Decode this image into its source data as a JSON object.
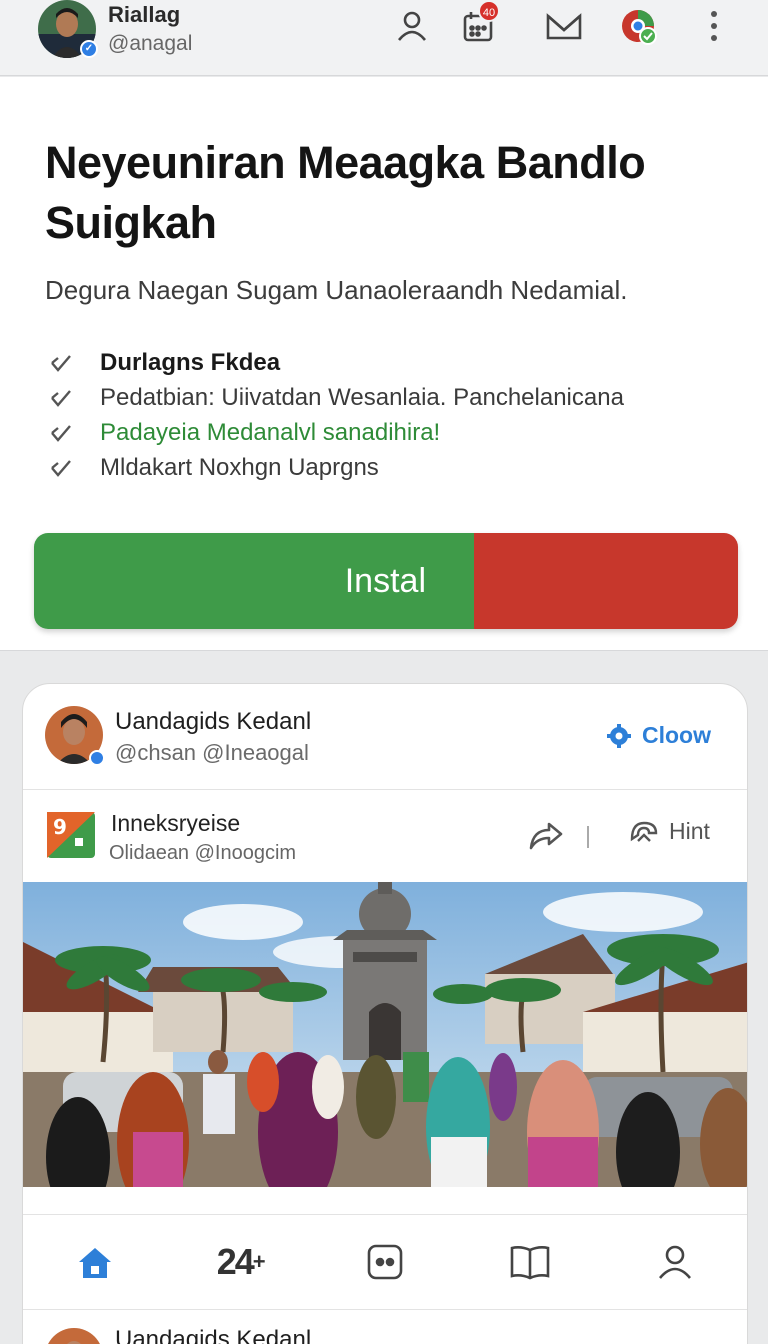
{
  "profile": {
    "name": "Riallag",
    "handle": "@anagal"
  },
  "topbar": {
    "calendar_badge": "40"
  },
  "promo": {
    "title": "Neyeuniran Meaagka Bandlo Suigkah",
    "subtitle": "Degura Naegan Sugam Uanaoleraandh Nedamial.",
    "features": [
      {
        "label": "Durlagns Fkdea"
      },
      {
        "label": "Pedatbian: Uiivatdan Wesanlaia. Panchelanicana"
      },
      {
        "label": "Padayeia Medanalvl sanadihira!"
      },
      {
        "label": "Mldakart Noxhgn Uaprgns"
      }
    ],
    "install_label": "Instal"
  },
  "post": {
    "author_name": "Uandagids Kedanl",
    "author_handle": "@chsan @Ineaogal",
    "follow_label": "Cloow",
    "sub_title": "Inneksryeise",
    "sub_handle": "Olidaean @Inoogcim",
    "hint_label": "Hint",
    "logo_text": "9"
  },
  "nav": {
    "counter_label": "24"
  },
  "next_post": {
    "author_name": "Uandagids Kedanl"
  },
  "colors": {
    "accent_green": "#3f9b49",
    "accent_red": "#c7372c",
    "link_blue": "#2d7fd8"
  }
}
